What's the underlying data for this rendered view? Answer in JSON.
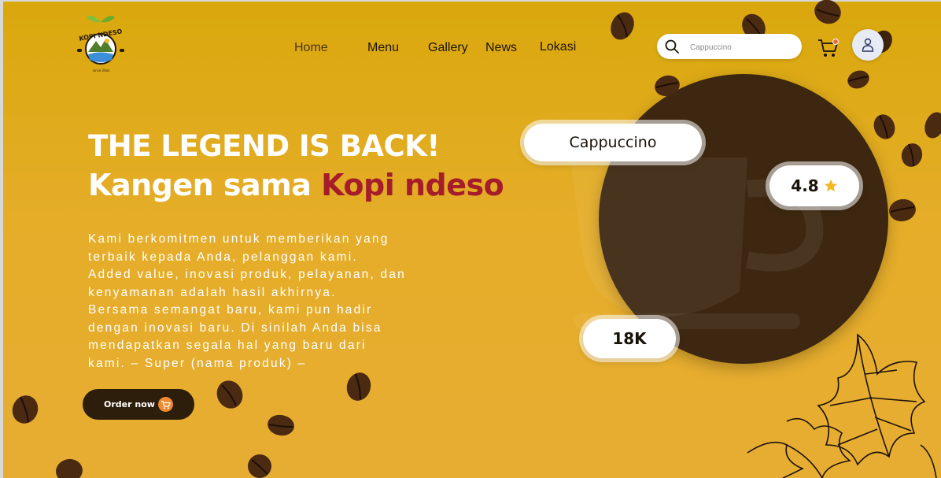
{
  "logo": {
    "text": "KOPI NDESO",
    "tagline": "since 20xx"
  },
  "nav": {
    "items": [
      {
        "label": "Home",
        "active": true
      },
      {
        "label": "Menu",
        "active": false
      },
      {
        "label": "Gallery",
        "active": false
      },
      {
        "label": "News",
        "active": false
      },
      {
        "label": "Lokasi",
        "active": false
      }
    ]
  },
  "search": {
    "placeholder": "Cappuccino"
  },
  "hero": {
    "headline": "THE LEGEND IS BACK!",
    "subline_prefix": "Kangen sama ",
    "subline_accent": "Kopi ndeso",
    "description": "Kami berkomitmen untuk memberikan yang\nterbaik kepada Anda, pelanggan kami.\nAdded value, inovasi produk, pelayanan, dan\nkenyamanan adalah hasil akhirnya.\nBersama semangat baru, kami pun hadir\ndengan inovasi baru. Di sinilah Anda bisa\nmendapatkan segala hal yang baru dari\nkami. – Super (nama produk) –",
    "cta_label": "Order now"
  },
  "product": {
    "name": "Cappuccino",
    "rating": "4.8",
    "count": "18K"
  },
  "colors": {
    "background_top": "#d9a80c",
    "background_bottom": "#e7ad33",
    "accent_red": "#a51d2a",
    "dark_brown": "#3d2710",
    "button_dark": "#2d1e0b",
    "cart_orange": "#ef8a2e",
    "star_yellow": "#f2b81f"
  },
  "icons": [
    "search-icon",
    "cart-icon",
    "user-icon",
    "star-icon",
    "coffee-bean-icon",
    "leaf-outline-icon",
    "coffee-cup-icon"
  ]
}
